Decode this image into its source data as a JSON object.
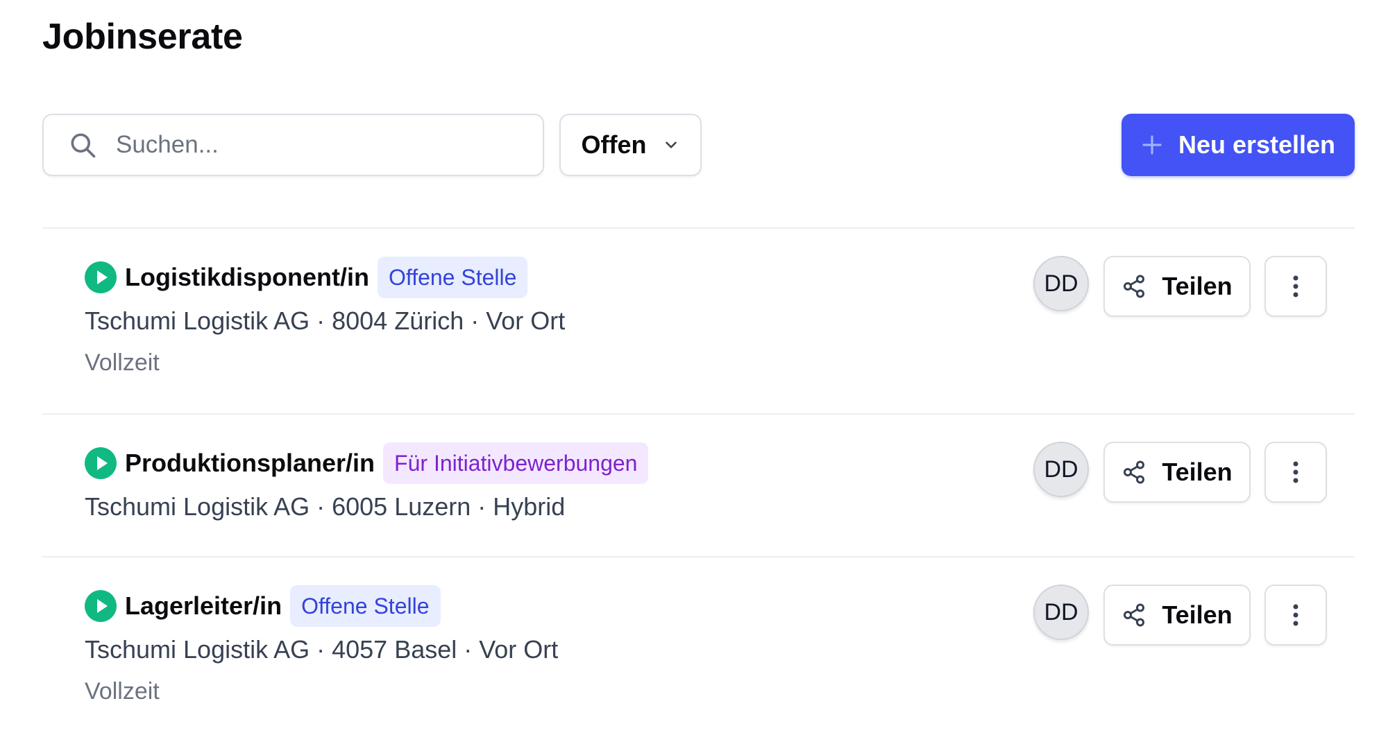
{
  "page": {
    "title": "Jobinserate"
  },
  "toolbar": {
    "search_placeholder": "Suchen...",
    "search_value": "",
    "filter_selected": "Offen",
    "create_label": "Neu erstellen",
    "accent_color": "#4353f5"
  },
  "jobs": [
    {
      "title": "Logistikdisponent/in",
      "badge": "Offene Stelle",
      "badge_style": "blue",
      "meta": "Tschumi Logistik AG · 8004 Zürich · Vor Ort",
      "employment": "Vollzeit",
      "status": "active",
      "avatar": "DD",
      "share_label": "Teilen"
    },
    {
      "title": "Produktionsplaner/in",
      "badge": "Für Initiativbewerbungen",
      "badge_style": "purple",
      "meta": "Tschumi Logistik AG · 6005 Luzern · Hybrid",
      "employment": "",
      "status": "active",
      "avatar": "DD",
      "share_label": "Teilen"
    },
    {
      "title": "Lagerleiter/in",
      "badge": "Offene Stelle",
      "badge_style": "blue",
      "meta": "Tschumi Logistik AG · 4057 Basel · Vor Ort",
      "employment": "Vollzeit",
      "status": "active",
      "avatar": "DD",
      "share_label": "Teilen"
    }
  ],
  "icons": {
    "search": "search-icon",
    "filter_chevron": "chevron-down-icon",
    "create": "plus-icon",
    "status": "play-circle-icon",
    "share": "share-icon",
    "more": "more-vertical-icon"
  },
  "colors": {
    "status_active": "#10b981",
    "badge_blue_bg": "#e8edff",
    "badge_blue_text": "#3443d8",
    "badge_purple_bg": "#f3e8ff",
    "badge_purple_text": "#7e22ce"
  }
}
